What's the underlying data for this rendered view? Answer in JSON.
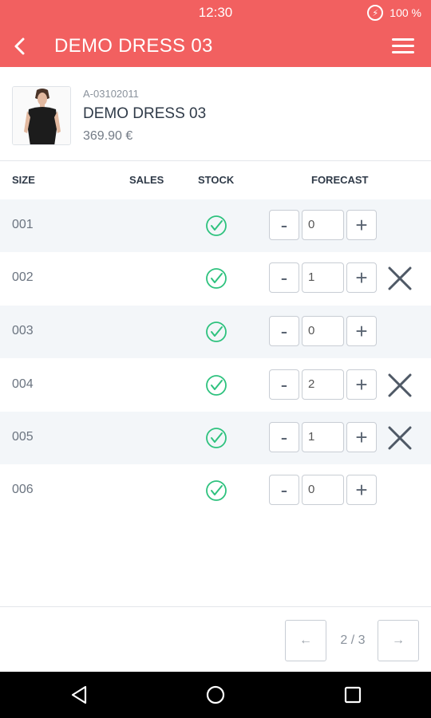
{
  "status_bar": {
    "time": "12:30",
    "battery": "100 %",
    "battery_icon": "battery-charging-icon"
  },
  "app_bar": {
    "title": "DEMO DRESS 03",
    "back_icon": "chevron-left-icon",
    "menu_icon": "hamburger-menu-icon"
  },
  "product": {
    "code": "A-03102011",
    "name": "DEMO DRESS 03",
    "price": "369.90 €"
  },
  "table": {
    "headers": {
      "size": "SIZE",
      "sales": "SALES",
      "stock": "STOCK",
      "forecast": "FORECAST"
    },
    "rows": [
      {
        "size": "001",
        "sales": "",
        "in_stock": true,
        "forecast": "0",
        "removable": false
      },
      {
        "size": "002",
        "sales": "",
        "in_stock": true,
        "forecast": "1",
        "removable": true
      },
      {
        "size": "003",
        "sales": "",
        "in_stock": true,
        "forecast": "0",
        "removable": false
      },
      {
        "size": "004",
        "sales": "",
        "in_stock": true,
        "forecast": "2",
        "removable": true
      },
      {
        "size": "005",
        "sales": "",
        "in_stock": true,
        "forecast": "1",
        "removable": true
      },
      {
        "size": "006",
        "sales": "",
        "in_stock": true,
        "forecast": "0",
        "removable": false
      }
    ],
    "minus_label": "-",
    "plus_label": "+"
  },
  "pager": {
    "prev": "←",
    "label": "2 / 3",
    "next": "→"
  },
  "colors": {
    "accent": "#f26060",
    "check": "#2ec27e",
    "row_alt": "#f3f6f9"
  }
}
